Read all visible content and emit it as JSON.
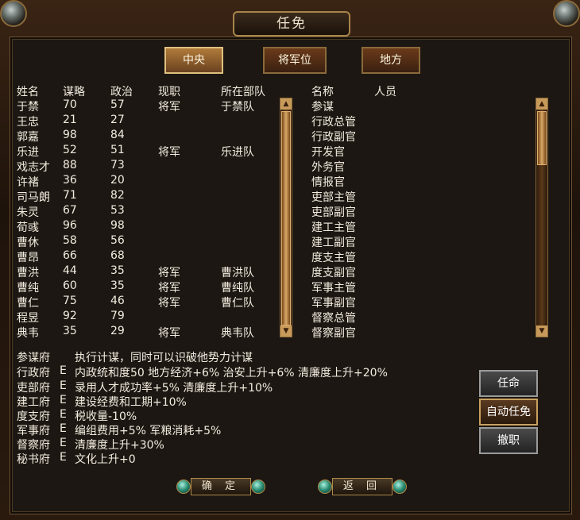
{
  "window": {
    "title": "任免"
  },
  "tabs": [
    {
      "label": "中央",
      "active": true
    },
    {
      "label": "将军位",
      "active": false
    },
    {
      "label": "地方",
      "active": false
    }
  ],
  "officer_table": {
    "headers": [
      "姓名",
      "谋略",
      "政治",
      "现职",
      "所在部队"
    ],
    "rows": [
      [
        "于禁",
        "70",
        "57",
        "将军",
        "于禁队"
      ],
      [
        "王忠",
        "21",
        "27",
        "",
        ""
      ],
      [
        "郭嘉",
        "98",
        "84",
        "",
        ""
      ],
      [
        "乐进",
        "52",
        "51",
        "将军",
        "乐进队"
      ],
      [
        "戏志才",
        "88",
        "73",
        "",
        ""
      ],
      [
        "许褚",
        "36",
        "20",
        "",
        ""
      ],
      [
        "司马朗",
        "71",
        "82",
        "",
        ""
      ],
      [
        "朱灵",
        "67",
        "53",
        "",
        ""
      ],
      [
        "荀彧",
        "96",
        "98",
        "",
        ""
      ],
      [
        "曹休",
        "58",
        "56",
        "",
        ""
      ],
      [
        "曹昂",
        "66",
        "68",
        "",
        ""
      ],
      [
        "曹洪",
        "44",
        "35",
        "将军",
        "曹洪队"
      ],
      [
        "曹纯",
        "60",
        "35",
        "将军",
        "曹纯队"
      ],
      [
        "曹仁",
        "75",
        "46",
        "将军",
        "曹仁队"
      ],
      [
        "程昱",
        "92",
        "79",
        "",
        ""
      ],
      [
        "典韦",
        "35",
        "29",
        "将军",
        "典韦队"
      ]
    ]
  },
  "position_table": {
    "headers": [
      "名称",
      "人员"
    ],
    "rows": [
      "参谋",
      "行政总管",
      "行政副官",
      "开发官",
      "外务官",
      "情报官",
      "吏部主管",
      "吏部副官",
      "建工主管",
      "建工副官",
      "度支主管",
      "度支副官",
      "军事主管",
      "军事副官",
      "督察总管",
      "督察副官"
    ]
  },
  "descriptions": [
    {
      "office": "参谋府",
      "grade": "",
      "text": "执行计谋，同时可以识破他势力计谋"
    },
    {
      "office": "行政府",
      "grade": "E",
      "text": "内政统和度50 地方经济+6% 治安上升+6% 清廉度上升+20%"
    },
    {
      "office": "吏部府",
      "grade": "E",
      "text": "录用人才成功率+5% 清廉度上升+10%"
    },
    {
      "office": "建工府",
      "grade": "E",
      "text": "建设经费和工期+10%"
    },
    {
      "office": "度支府",
      "grade": "E",
      "text": "税收量-10%"
    },
    {
      "office": "军事府",
      "grade": "E",
      "text": "编组费用+5% 军粮消耗+5%"
    },
    {
      "office": "督察府",
      "grade": "E",
      "text": "清廉度上升+30%"
    },
    {
      "office": "秘书府",
      "grade": "E",
      "text": "文化上升+0"
    }
  ],
  "buttons": {
    "appoint": "任命",
    "auto_appoint": "自动任免",
    "dismiss": "撤职",
    "confirm": "确 定",
    "back": "返 回"
  },
  "icons": {
    "arrow_up": "▲",
    "arrow_down": "▼"
  },
  "colors": {
    "text": "#f2ecdf",
    "frame_gold": "#a8844a",
    "panel": "#1c1712"
  }
}
